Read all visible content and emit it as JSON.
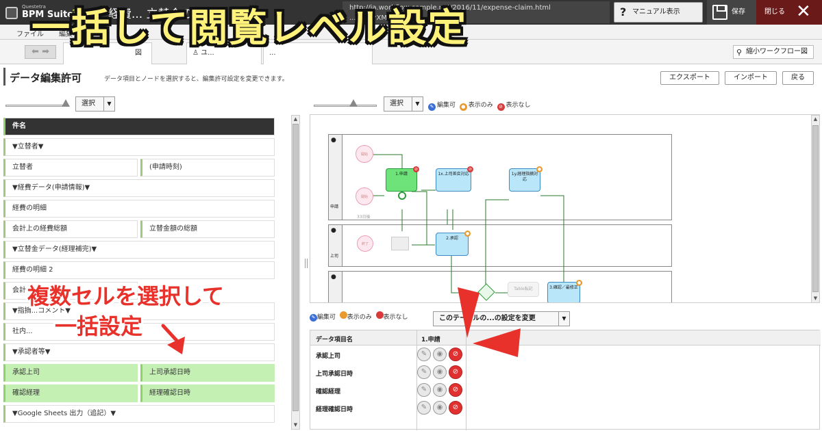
{
  "app": {
    "brand_small": "Questetra",
    "brand_name": "BPM Suite",
    "brand_version": "11.5",
    "title": "経費... 立替金の報告",
    "url": "http://ja.workflow-sample.net/2016/11/expense-claim.html",
    "url_sub": "...ジョンXML",
    "manual_label": "マニュアル表示",
    "save_label": "保存",
    "close_label": "閉じる"
  },
  "menu": {
    "items": [
      "ファイル",
      "編集"
    ]
  },
  "tabs": {
    "mini_workflow": "縮小ワークフロー図",
    "tab1": "図",
    "tab2": "ユ...",
    "tab3": "..."
  },
  "section": {
    "title": "データ編集許可",
    "description": "データ項目とノードを選択すると、編集許可設定を変更できます。",
    "export_label": "エクスポート",
    "import_label": "インポート",
    "back_label": "戻る"
  },
  "controls": {
    "select_label": "選択",
    "legend_editable": "編集可",
    "legend_view_only": "表示のみ",
    "legend_hidden": "表示なし",
    "table_change_label": "このテーブルの...の設定を変更"
  },
  "left_rows": [
    {
      "label": "件名"
    },
    {
      "label": "▼立替者▼"
    },
    {
      "label": "立替者"
    },
    {
      "label": "(申請時刻)"
    },
    {
      "label": "▼経費データ(申請情報)▼"
    },
    {
      "label": "経費の明細"
    },
    {
      "label": "会計上の経費総額"
    },
    {
      "label": "立替金額の総額"
    },
    {
      "label": "▼立替金データ(経理補完)▼"
    },
    {
      "label": "経費の明細 2"
    },
    {
      "label": "会計上..."
    },
    {
      "label": "▼指摘...コメント▼"
    },
    {
      "label": "社内..."
    },
    {
      "label": "▼承認者等▼"
    },
    {
      "label": "承認上司"
    },
    {
      "label": "上司承認日時"
    },
    {
      "label": "確認経理"
    },
    {
      "label": "経理確認日時"
    },
    {
      "label": "▼Google Sheets 出力（追記）▼"
    }
  ],
  "diagram": {
    "lane1_label": "申請",
    "lane2_label": "上司",
    "start_label": "開始",
    "node_apply": "1.申請",
    "node_1x": "1x.上司差戻対応",
    "node_1y": "1y.経理指摘対応",
    "node_approve": "2.承認",
    "node_confirm": "3.確認／最修正",
    "end_label": "終了",
    "timer_label": "33日後",
    "table_label": "Table転記"
  },
  "grid": {
    "col_header": "データ項目名",
    "node_header": "1.申請",
    "rows": [
      "承認上司",
      "上司承認日時",
      "確認経理",
      "経理確認日時"
    ]
  },
  "overlay": {
    "headline": "一括して閲覧レベル設定",
    "callout_line1": "複数セルを選択して",
    "callout_line2": "一括設定"
  },
  "colors": {
    "editable": "#3a6fd8",
    "view_only": "#e89a2c",
    "hidden": "#d93a3a",
    "accent_green": "#8fd26a"
  }
}
